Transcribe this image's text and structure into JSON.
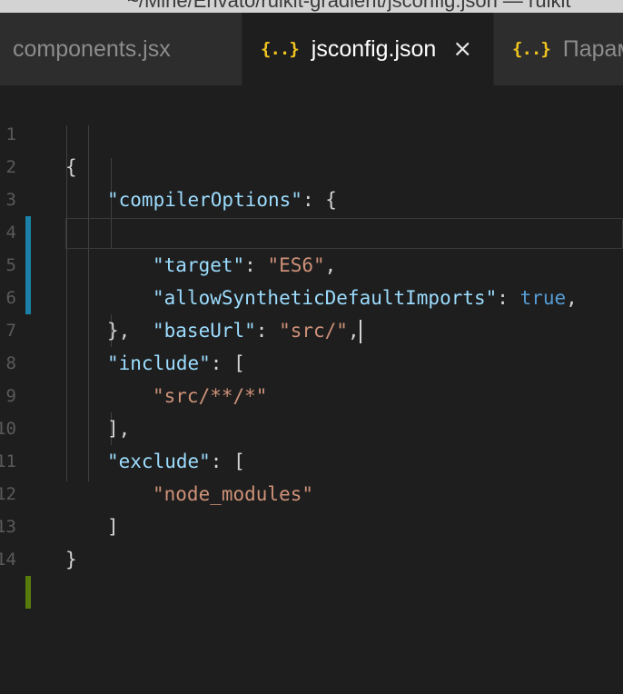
{
  "window": {
    "title": "~/Mine/Envato/ruikit-gradient/jsconfig.json — ruikit"
  },
  "tabs": [
    {
      "label": "components.jsx",
      "active": false,
      "icon": ""
    },
    {
      "label": "jsconfig.json",
      "active": true,
      "icon": "json-braces-icon",
      "icon_glyph": "{..}",
      "close": "×"
    },
    {
      "label": "Парам",
      "active": false,
      "icon": "json-braces-icon",
      "icon_glyph": "{..}"
    }
  ],
  "editor": {
    "line_numbers": [
      "1",
      "2",
      "3",
      "4",
      "5",
      "6",
      "7",
      "8",
      "9",
      "10",
      "11",
      "12",
      "13",
      "14"
    ],
    "lines": [
      {
        "tokens": [
          {
            "t": "{",
            "c": "p"
          }
        ]
      },
      {
        "tokens": [
          {
            "t": "\"compilerOptions\"",
            "c": "k"
          },
          {
            "t": ": {",
            "c": "p"
          }
        ]
      },
      {
        "tokens": [
          {
            "t": "\"target\"",
            "c": "k"
          },
          {
            "t": ": ",
            "c": "p"
          },
          {
            "t": "\"ES6\"",
            "c": "s"
          },
          {
            "t": ",",
            "c": "p"
          }
        ]
      },
      {
        "tokens": [
          {
            "t": "\"allowSyntheticDefaultImports\"",
            "c": "k"
          },
          {
            "t": ": ",
            "c": "p"
          },
          {
            "t": "true",
            "c": "b"
          },
          {
            "t": ",",
            "c": "p"
          }
        ]
      },
      {
        "tokens": [
          {
            "t": "\"baseUrl\"",
            "c": "k"
          },
          {
            "t": ": ",
            "c": "p"
          },
          {
            "t": "\"src/\"",
            "c": "s"
          },
          {
            "t": ",",
            "c": "p"
          }
        ]
      },
      {
        "tokens": [
          {
            "t": "},",
            "c": "p"
          }
        ]
      },
      {
        "tokens": [
          {
            "t": "\"include\"",
            "c": "k"
          },
          {
            "t": ": [",
            "c": "p"
          }
        ]
      },
      {
        "tokens": [
          {
            "t": "\"src/**/*\"",
            "c": "s"
          }
        ]
      },
      {
        "tokens": [
          {
            "t": "],",
            "c": "p"
          }
        ]
      },
      {
        "tokens": [
          {
            "t": "\"exclude\"",
            "c": "k"
          },
          {
            "t": ": [",
            "c": "p"
          }
        ]
      },
      {
        "tokens": [
          {
            "t": "\"node_modules\"",
            "c": "s"
          }
        ]
      },
      {
        "tokens": [
          {
            "t": "]",
            "c": "p"
          }
        ]
      },
      {
        "tokens": [
          {
            "t": "}",
            "c": "p"
          }
        ]
      },
      {
        "tokens": []
      }
    ],
    "modified_marker_color": "#1b81a8",
    "added_marker_color": "#587c0c"
  }
}
